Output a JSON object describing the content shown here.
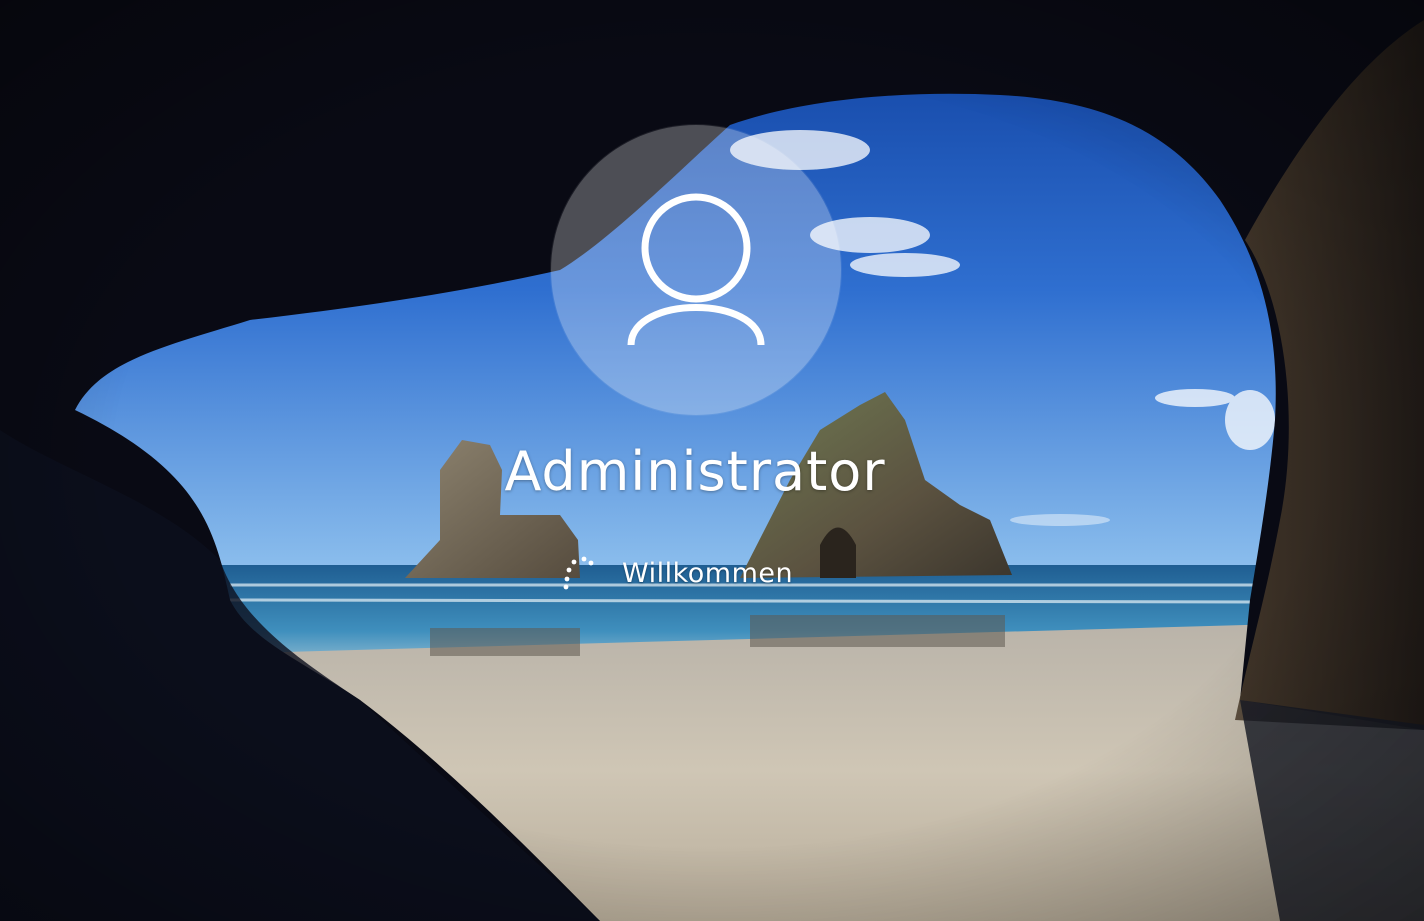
{
  "login": {
    "username": "Administrator",
    "status_text": "Willkommen",
    "avatar_icon": "user-icon",
    "spinner_icon": "loading-spinner-icon"
  },
  "colors": {
    "text": "#ffffff",
    "avatar_circle": "rgba(255,255,255,0.28)",
    "sky": "#1f5fc4",
    "sea": "#2f7fb2",
    "sand": "#c9c1b1",
    "cave": "#0a0b14"
  }
}
